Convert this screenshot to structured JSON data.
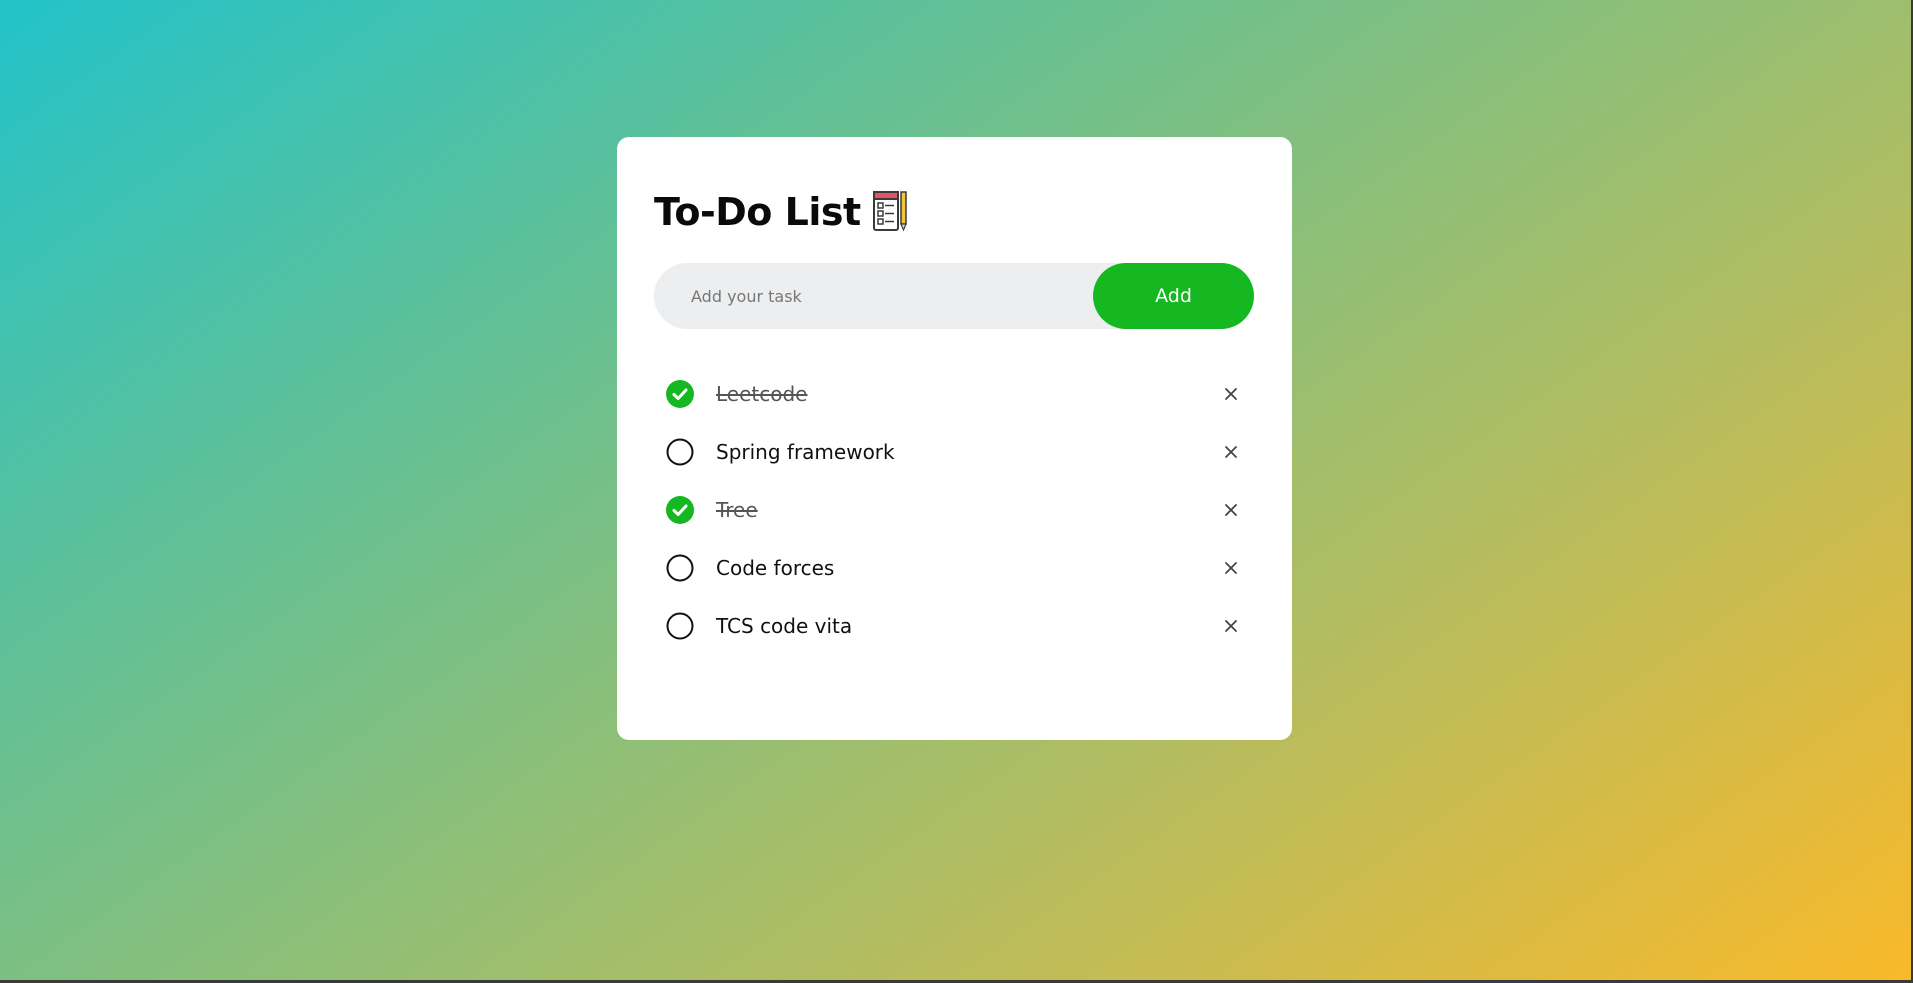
{
  "app": {
    "title": "To-Do List",
    "title_icon": "notepad-checklist-pencil-icon"
  },
  "input": {
    "placeholder": "Add your task",
    "value": ""
  },
  "add_button": {
    "label": "Add"
  },
  "colors": {
    "accent": "#16b821",
    "check_done": "#16b821",
    "background_gradient_start": "#22c3c9",
    "background_gradient_end": "#f9b92a"
  },
  "tasks": [
    {
      "text": "Leetcode",
      "done": true
    },
    {
      "text": "Spring framework",
      "done": false
    },
    {
      "text": "Tree",
      "done": true
    },
    {
      "text": "Code forces",
      "done": false
    },
    {
      "text": "TCS code vita",
      "done": false
    }
  ],
  "icons": {
    "check_done": "check-circle-filled-icon",
    "check_open": "circle-outline-icon",
    "delete": "close-icon"
  }
}
